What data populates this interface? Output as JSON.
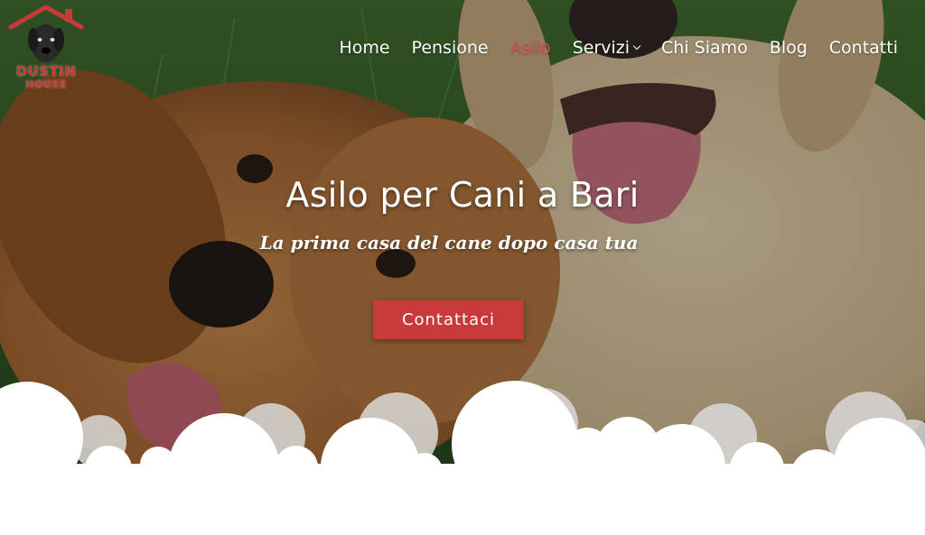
{
  "brand": {
    "line1": "DUSTIN",
    "line2": "HOUSE"
  },
  "nav": {
    "items": [
      {
        "label": "Home",
        "active": false,
        "dropdown": false
      },
      {
        "label": "Pensione",
        "active": false,
        "dropdown": false
      },
      {
        "label": "Asilo",
        "active": true,
        "dropdown": false
      },
      {
        "label": "Servizi",
        "active": false,
        "dropdown": true
      },
      {
        "label": "Chi Siamo",
        "active": false,
        "dropdown": false
      },
      {
        "label": "Blog",
        "active": false,
        "dropdown": false
      },
      {
        "label": "Contatti",
        "active": false,
        "dropdown": false
      }
    ]
  },
  "hero": {
    "title": "Asilo per Cani a Bari",
    "subtitle": "La prima casa del cane dopo casa tua",
    "cta_label": "Contattaci"
  },
  "colors": {
    "accent": "#c83a3a",
    "nav_active": "#d9534f",
    "text_light": "#ffffff",
    "background": "#ffffff"
  }
}
